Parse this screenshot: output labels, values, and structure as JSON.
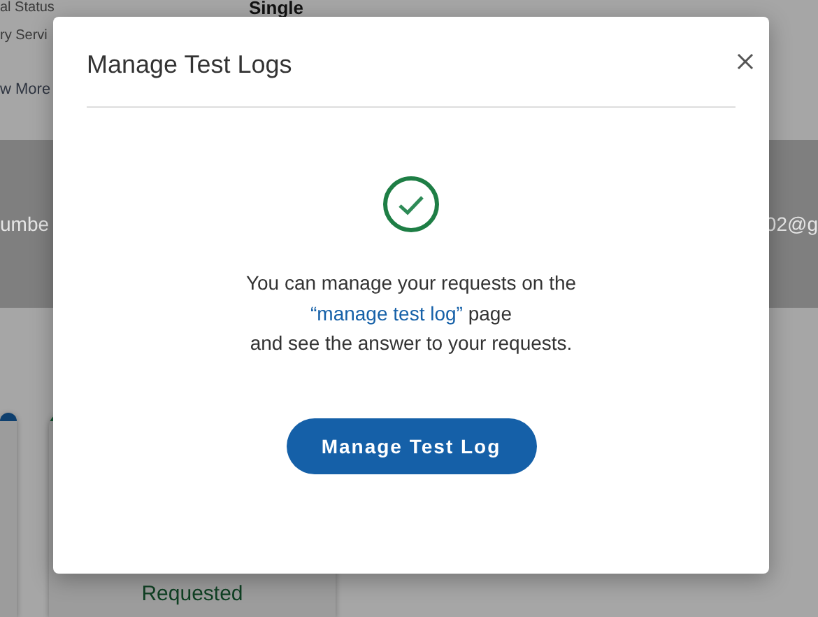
{
  "background": {
    "fields": [
      {
        "label": "al Status",
        "value": "Single"
      },
      {
        "label": "ry Servi"
      }
    ],
    "view_more_link": "w More",
    "band": {
      "left": "umbe",
      "right": "02@g"
    },
    "cards": [
      {
        "color": "#0e3f6e"
      },
      {
        "color": "#145230",
        "status": "Requested"
      }
    ]
  },
  "dialog": {
    "title": "Manage Test Logs",
    "message": {
      "before": "You can manage your requests on the",
      "link": "“manage test log”",
      "after": "page",
      "rest": "and see the answer to your requests."
    },
    "button": "Manage Test Log"
  }
}
